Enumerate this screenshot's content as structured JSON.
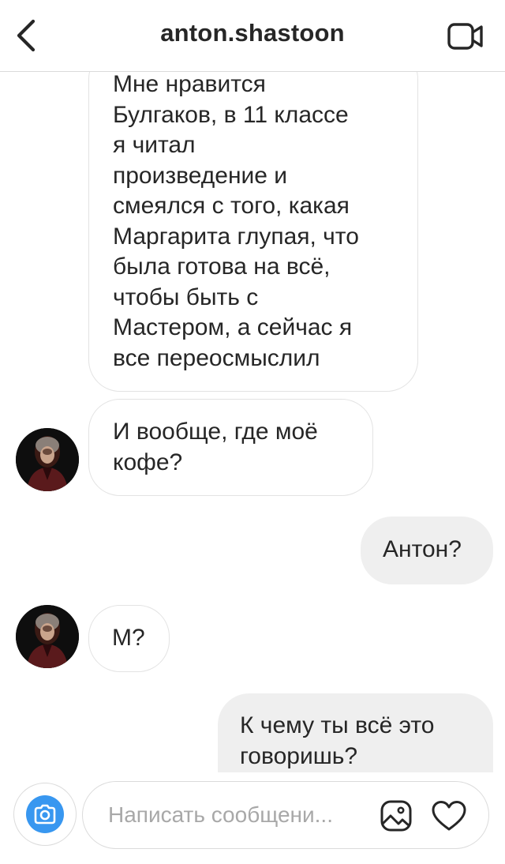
{
  "header": {
    "title": "anton.shastoon",
    "back_icon": "chevron-left-icon",
    "video_icon": "video-camera-icon"
  },
  "messages": [
    {
      "direction": "incoming",
      "text": "Мне нравится\nБулгаков, в 11 классе\nя читал\nпроизведение и\nсмеялся с того, какая\nМаргарита глупая, что\nбыла готова на всё,\nчтобы быть с\nМастером, а сейчас я\nвсе переосмыслил"
    },
    {
      "direction": "incoming",
      "text": "И вообще, где моё\nкофе?"
    },
    {
      "direction": "outgoing",
      "text": "Антон?"
    },
    {
      "direction": "incoming",
      "text": "М?"
    },
    {
      "direction": "outgoing",
      "text": "К чему ты всё это\nговоришь?"
    }
  ],
  "composer": {
    "placeholder": "Написать сообщени...",
    "value": "",
    "camera_icon": "camera-icon",
    "gallery_icon": "image-gallery-icon",
    "like_icon": "heart-icon"
  },
  "colors": {
    "accent": "#3897f0",
    "incoming_bubble": "#ffffff",
    "outgoing_bubble": "#efefef",
    "text": "#262626",
    "placeholder": "#a8a8a8",
    "border": "#dbdbdb"
  }
}
